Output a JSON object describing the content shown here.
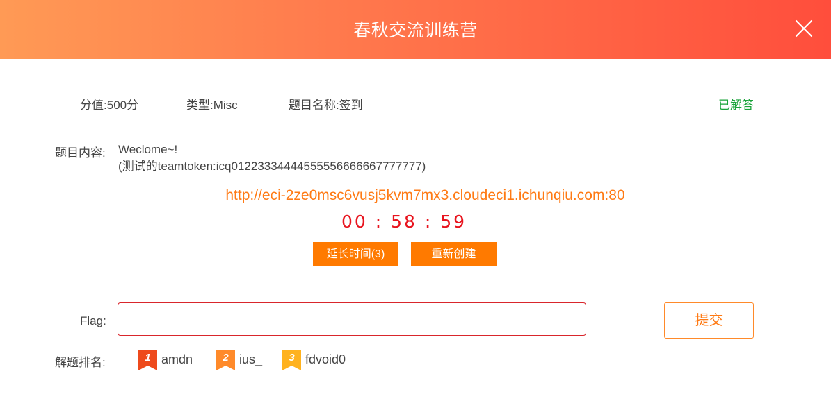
{
  "header": {
    "title": "春秋交流训练营"
  },
  "info": {
    "score_label": "分值:",
    "score_value": "500分",
    "type_label": "类型:",
    "type_value": "Misc",
    "name_label": "题目名称:",
    "name_value": "签到",
    "status": "已解答",
    "status_color": "#1aa33a"
  },
  "content": {
    "label": "题目内容:",
    "line1": "Weclome~!",
    "line2": "(测试的teamtoken:icq01223334444555556666667777777)"
  },
  "challenge": {
    "url": "http://eci-2ze0msc6vusj5kvm7mx3.cloudeci1.ichunqiu.com:80",
    "timer": "00 : 58 : 59",
    "extend_button": "延长时间(3)",
    "recreate_button": "重新创建"
  },
  "flag": {
    "label": "Flag:",
    "value": "",
    "placeholder": "",
    "submit_button": "提交"
  },
  "ranking": {
    "label": "解题排名:",
    "entries": [
      {
        "rank": "1",
        "name": "amdn",
        "color": "#ee4a1c"
      },
      {
        "rank": "2",
        "name": "ius_",
        "color": "#ff8a2a"
      },
      {
        "rank": "3",
        "name": "fdvoid0",
        "color": "#ffb21e"
      }
    ]
  },
  "colors": {
    "accent_orange": "#ff7a00",
    "timer_red": "#e8141e",
    "input_border": "#d9262c"
  }
}
